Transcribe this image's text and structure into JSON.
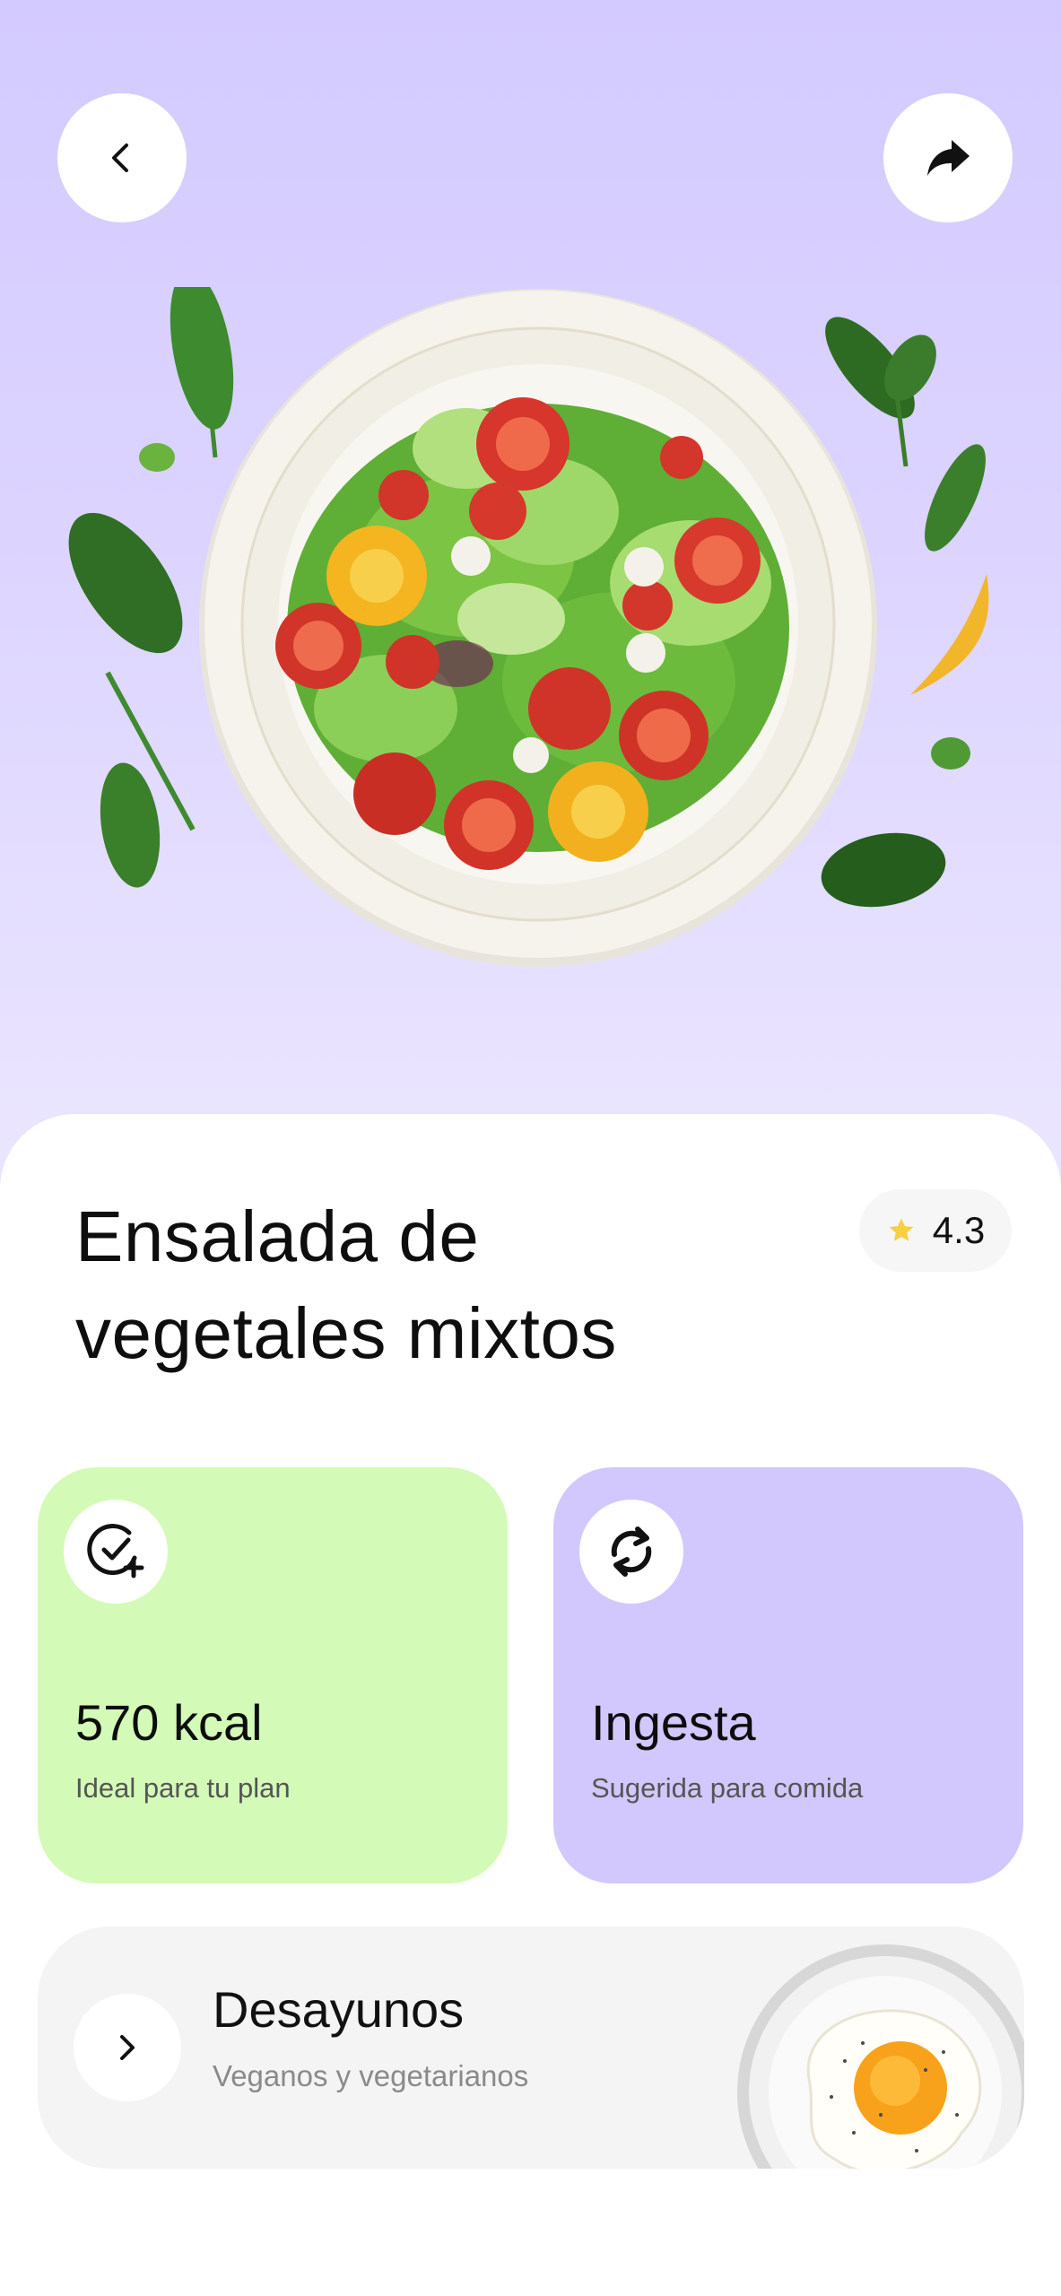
{
  "header": {
    "back_icon": "chevron-left-icon",
    "share_icon": "share-arrow-icon"
  },
  "hero": {
    "image": "mixed-salad-plate",
    "background_color": "#d3caff"
  },
  "recipe": {
    "title_line1": "Ensalada de",
    "title_line2": "vegetales mixtos",
    "rating": "4.3",
    "rating_icon": "star-icon"
  },
  "cards": [
    {
      "value": "570 kcal",
      "subtitle": "Ideal para tu plan",
      "icon": "check-plus-icon",
      "color": "#d3fbb7"
    },
    {
      "value": "Ingesta",
      "subtitle": "Sugerida para comida",
      "icon": "refresh-icon",
      "color": "#d2c8fd"
    }
  ],
  "category": {
    "title": "Desayunos",
    "subtitle": "Veganos y vegetarianos",
    "arrow_icon": "chevron-right-icon",
    "image": "fried-egg-plate"
  }
}
